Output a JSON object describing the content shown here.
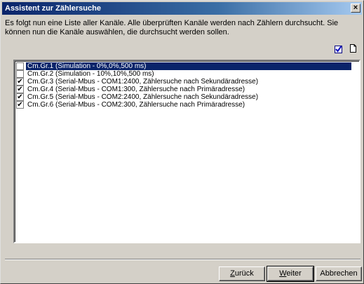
{
  "window": {
    "title": "Assistent zur Zählersuche",
    "close_label": "×"
  },
  "intro": {
    "text": "Es folgt nun eine Liste aller Kanäle. Alle überprüften Kanäle werden nach Zählern durchsucht. Sie können nun die Kanäle auswählen, die durchsucht werden sollen."
  },
  "toolbar": {
    "check_all_icon": "check-all-icon",
    "uncheck_all_icon": "page-icon"
  },
  "channels": [
    {
      "label": "Cm.Gr.1 (Simulation - 0%,0%,500 ms)",
      "checked": false,
      "selected": true
    },
    {
      "label": "Cm.Gr.2 (Simulation - 10%,10%,500 ms)",
      "checked": false,
      "selected": false
    },
    {
      "label": "Cm.Gr.3 (Serial-Mbus - COM1:2400, Zählersuche nach Sekundäradresse)",
      "checked": true,
      "selected": false
    },
    {
      "label": "Cm.Gr.4 (Serial-Mbus - COM1:300, Zählersuche nach Primäradresse)",
      "checked": true,
      "selected": false
    },
    {
      "label": "Cm.Gr.5 (Serial-Mbus - COM2:2400, Zählersuche nach Sekundäradresse)",
      "checked": true,
      "selected": false
    },
    {
      "label": "Cm.Gr.6 (Serial-Mbus - COM2:300, Zählersuche nach Primäradresse)",
      "checked": true,
      "selected": false
    }
  ],
  "buttons": {
    "back": {
      "mnemonic": "Z",
      "rest": "urück"
    },
    "next": {
      "mnemonic": "W",
      "rest": "eiter"
    },
    "cancel": "Abbrechen"
  }
}
